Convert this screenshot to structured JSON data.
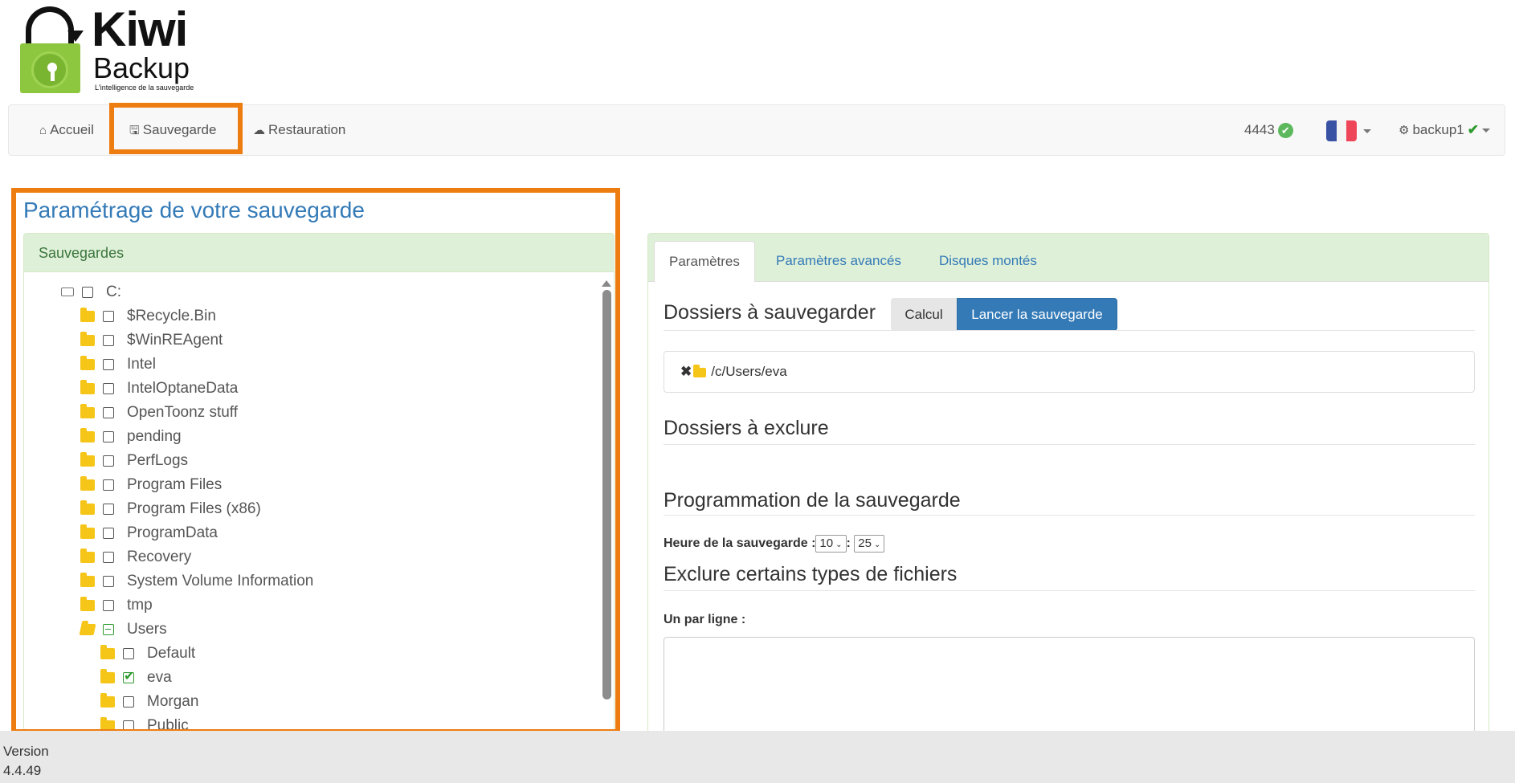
{
  "logo": {
    "brand": "Kiwi",
    "product": "Backup",
    "tagline": "L'intelligence de la sauvegarde"
  },
  "nav": {
    "items": [
      {
        "label": "Accueil",
        "icon": "home-icon"
      },
      {
        "label": "Sauvegarde",
        "icon": "floppy-disk-icon"
      },
      {
        "label": "Restauration",
        "icon": "cloud-download-icon"
      }
    ],
    "count": "4443",
    "language": "fr",
    "user": "backup1"
  },
  "page_title": "Paramétrage de votre sauvegarde",
  "left_panel": {
    "heading": "Sauvegardes",
    "tree": [
      {
        "label": "C:",
        "level": 0,
        "type": "drive",
        "state": "unchecked"
      },
      {
        "label": "$Recycle.Bin",
        "level": 1,
        "type": "folder",
        "state": "unchecked"
      },
      {
        "label": "$WinREAgent",
        "level": 1,
        "type": "folder",
        "state": "unchecked"
      },
      {
        "label": "Intel",
        "level": 1,
        "type": "folder",
        "state": "unchecked"
      },
      {
        "label": "IntelOptaneData",
        "level": 1,
        "type": "folder",
        "state": "unchecked"
      },
      {
        "label": "OpenToonz stuff",
        "level": 1,
        "type": "folder",
        "state": "unchecked"
      },
      {
        "label": "pending",
        "level": 1,
        "type": "folder",
        "state": "unchecked"
      },
      {
        "label": "PerfLogs",
        "level": 1,
        "type": "folder",
        "state": "unchecked"
      },
      {
        "label": "Program Files",
        "level": 1,
        "type": "folder",
        "state": "unchecked"
      },
      {
        "label": "Program Files (x86)",
        "level": 1,
        "type": "folder",
        "state": "unchecked"
      },
      {
        "label": "ProgramData",
        "level": 1,
        "type": "folder",
        "state": "unchecked"
      },
      {
        "label": "Recovery",
        "level": 1,
        "type": "folder",
        "state": "unchecked"
      },
      {
        "label": "System Volume Information",
        "level": 1,
        "type": "folder",
        "state": "unchecked"
      },
      {
        "label": "tmp",
        "level": 1,
        "type": "folder",
        "state": "unchecked"
      },
      {
        "label": "Users",
        "level": 1,
        "type": "folder-open",
        "state": "partial"
      },
      {
        "label": "Default",
        "level": 2,
        "type": "folder",
        "state": "unchecked"
      },
      {
        "label": "eva",
        "level": 2,
        "type": "folder",
        "state": "checked"
      },
      {
        "label": "Morgan",
        "level": 2,
        "type": "folder",
        "state": "unchecked"
      },
      {
        "label": "Public",
        "level": 2,
        "type": "folder",
        "state": "unchecked"
      }
    ]
  },
  "right_panel": {
    "tabs": [
      "Paramètres",
      "Paramètres avancés",
      "Disques montés"
    ],
    "active_tab": "Paramètres",
    "backup_folders_title": "Dossiers à sauvegarder",
    "calc_button": "Calcul",
    "run_button": "Lancer la sauvegarde",
    "backup_path": "/c/Users/eva",
    "exclude_title": "Dossiers à exclure",
    "schedule_title": "Programmation de la sauvegarde",
    "schedule_label": "Heure de la sauvegarde :",
    "hour": "10",
    "minute": "25",
    "exclude_types_title": "Exclure certains types de fichiers",
    "one_per_line_label": "Un par ligne :",
    "textarea_value": ""
  },
  "footer": {
    "version_label": "Version",
    "version": "4.4.49"
  },
  "colors": {
    "accent": "#337ab7",
    "highlight": "#ee7d11",
    "panel_green": "#dff0d8",
    "logo_green": "#8dc63f"
  }
}
